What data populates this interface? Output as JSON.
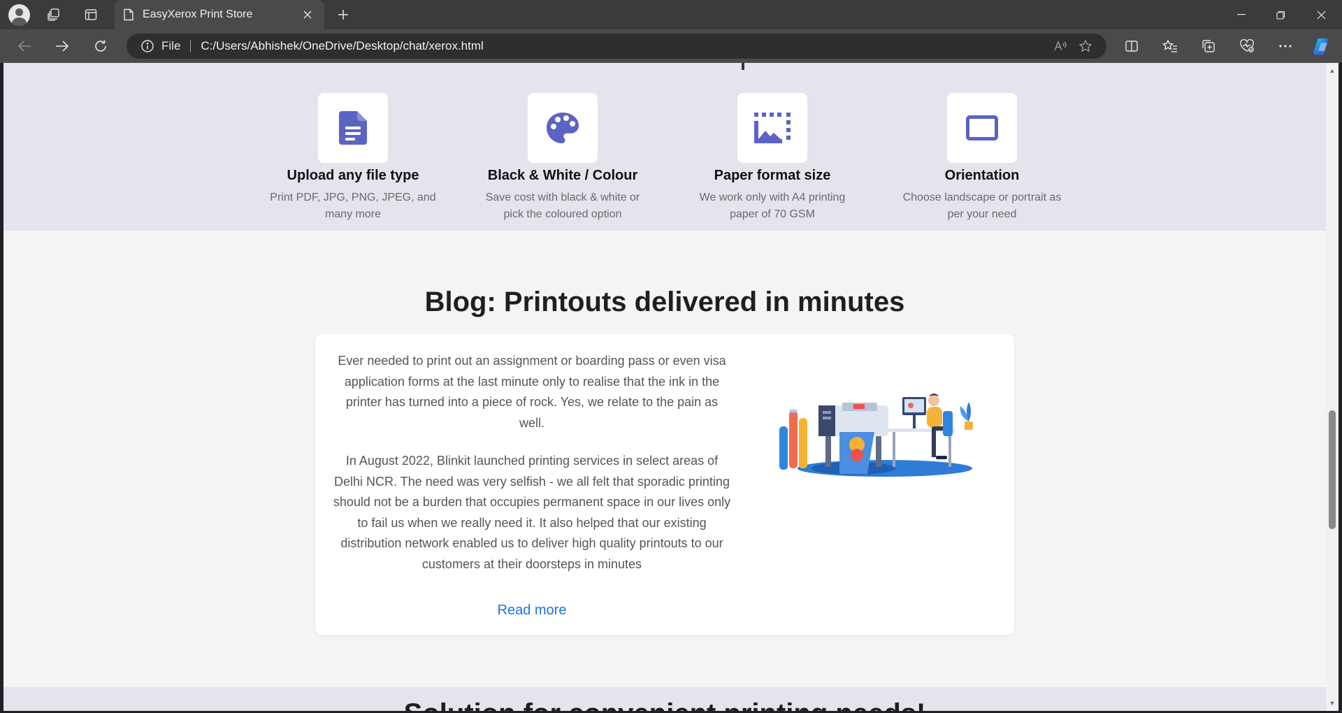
{
  "browser": {
    "tab_title": "EasyXerox Print Store",
    "scheme_label": "File",
    "url": "C:/Users/Abhishek/OneDrive/Desktop/chat/xerox.html"
  },
  "features": [
    {
      "title": "Upload any file type",
      "desc": "Print PDF, JPG, PNG, JPEG, and many more",
      "icon": "document-icon"
    },
    {
      "title": "Black & White / Colour",
      "desc": "Save cost with black & white or pick the coloured option",
      "icon": "palette-icon"
    },
    {
      "title": "Paper format size",
      "desc": "We work only with A4 printing paper of 70 GSM",
      "icon": "photo-size-icon"
    },
    {
      "title": "Orientation",
      "desc": "Choose landscape or portrait as per your need",
      "icon": "rectangle-icon"
    }
  ],
  "blog": {
    "title": "Blog: Printouts delivered in minutes",
    "paragraphs": [
      "Ever needed to print out an assignment or boarding pass or even visa application forms at the last minute only to realise that the ink in the printer has turned into a piece of rock. Yes, we relate to the pain as well.",
      "In August 2022, Blinkit launched printing services in select areas of Delhi NCR. The need was very selfish - we all felt that sporadic printing should not be a burden that occupies permanent space in our lives only to fail us when we really need it. It also helped that our existing distribution network enabled us to deliver high quality printouts to our customers at their doorsteps in minutes"
    ],
    "read_more": "Read more"
  },
  "solution": {
    "title": "Solution for convenient printing needs!"
  },
  "colors": {
    "accent": "#5b63c4",
    "link": "#1a73e8",
    "section_bg": "#e3e4ec",
    "page_bg": "#f4f4f5"
  }
}
